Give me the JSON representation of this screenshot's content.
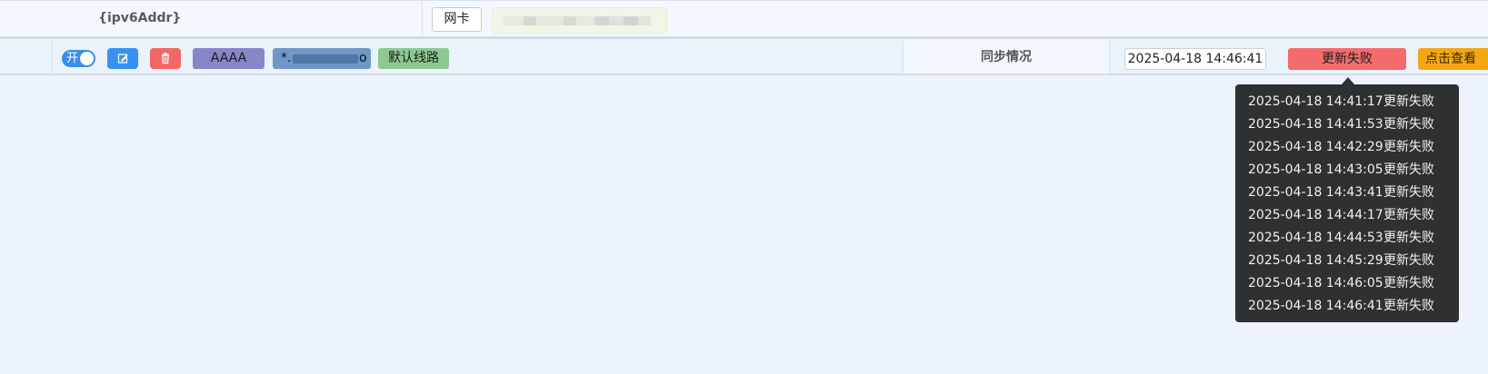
{
  "top_row": {
    "ipv6_label": "{ipv6Addr}",
    "nic_button": "网卡"
  },
  "record_row": {
    "toggle_label": "开",
    "toggle_on": true,
    "record_type": "AAAA",
    "domain_prefix": "*.",
    "domain_suffix": "o",
    "line": "默认线路",
    "sync_label": "同步情况",
    "last_update_time": "2025-04-18 14:46:41",
    "status": "更新失败",
    "view_button": "点击查看"
  },
  "tooltip": {
    "history": [
      {
        "time": "2025-04-18 14:41:17",
        "status": "更新失败"
      },
      {
        "time": "2025-04-18 14:41:53",
        "status": "更新失败"
      },
      {
        "time": "2025-04-18 14:42:29",
        "status": "更新失败"
      },
      {
        "time": "2025-04-18 14:43:05",
        "status": "更新失败"
      },
      {
        "time": "2025-04-18 14:43:41",
        "status": "更新失败"
      },
      {
        "time": "2025-04-18 14:44:17",
        "status": "更新失败"
      },
      {
        "time": "2025-04-18 14:44:53",
        "status": "更新失败"
      },
      {
        "time": "2025-04-18 14:45:29",
        "status": "更新失败"
      },
      {
        "time": "2025-04-18 14:46:05",
        "status": "更新失败"
      },
      {
        "time": "2025-04-18 14:46:41",
        "status": "更新失败"
      }
    ]
  },
  "icons": {
    "edit": "edit-icon",
    "delete": "trash-icon"
  },
  "colors": {
    "toggle_on": "#3a8ee6",
    "edit_button": "#3592f0",
    "delete_button": "#f16767",
    "record_type_tag": "#8886c9",
    "domain_tag": "#6f97c8",
    "line_tag": "#8cc98f",
    "status_fail": "#f36b6b",
    "view_button": "#f4a713",
    "tooltip_bg": "#2f3032"
  }
}
